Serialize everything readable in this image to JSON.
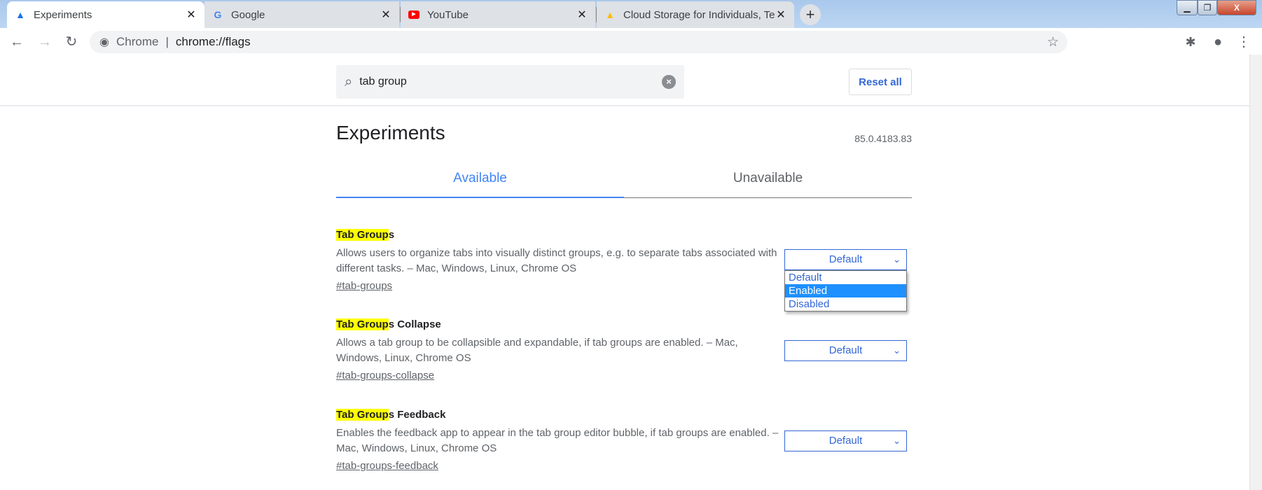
{
  "browser": {
    "tabs": [
      {
        "label": "Experiments",
        "icon": "flask-icon",
        "active": true
      },
      {
        "label": "Google",
        "icon": "google-icon"
      },
      {
        "label": "YouTube",
        "icon": "youtube-icon"
      },
      {
        "label": "Cloud Storage for Individuals, Te",
        "icon": "google-drive-icon"
      }
    ],
    "omnibox": {
      "scheme_label": "Chrome",
      "url": "chrome://flags"
    }
  },
  "search": {
    "value": "tab group"
  },
  "reset_label": "Reset all",
  "page": {
    "title": "Experiments",
    "version": "85.0.4183.83"
  },
  "tabs": {
    "available": "Available",
    "unavailable": "Unavailable"
  },
  "flags": [
    {
      "title_hl": "Tab Group",
      "title_rest": "s",
      "description": "Allows users to organize tabs into visually distinct groups, e.g. to separate tabs associated with different tasks. – Mac, Windows, Linux, Chrome OS",
      "link": "#tab-groups",
      "value": "Default"
    },
    {
      "title_hl": "Tab Group",
      "title_rest": "s Collapse",
      "description": "Allows a tab group to be collapsible and expandable, if tab groups are enabled. – Mac, Windows, Linux, Chrome OS",
      "link": "#tab-groups-collapse",
      "value": "Default"
    },
    {
      "title_hl": "Tab Group",
      "title_rest": "s Feedback",
      "description": "Enables the feedback app to appear in the tab group editor bubble, if tab groups are enabled. – Mac, Windows, Linux, Chrome OS",
      "link": "#tab-groups-feedback",
      "value": "Default"
    }
  ],
  "dropdown": {
    "options": [
      "Default",
      "Enabled",
      "Disabled"
    ],
    "highlighted": "Enabled"
  },
  "colors": {
    "accent": "#3367d6",
    "highlight": "#ffff00",
    "selected_option": "#1e90ff"
  }
}
